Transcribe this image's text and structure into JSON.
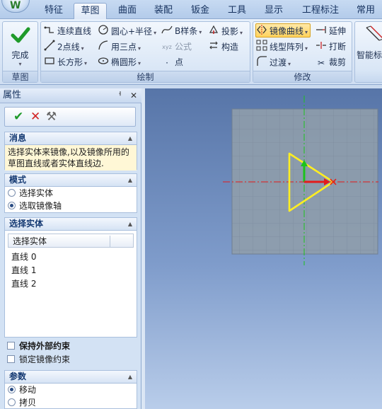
{
  "tabs": [
    {
      "label": "特征",
      "active": false
    },
    {
      "label": "草图",
      "active": true
    },
    {
      "label": "曲面",
      "active": false
    },
    {
      "label": "装配",
      "active": false
    },
    {
      "label": "钣金",
      "active": false
    },
    {
      "label": "工具",
      "active": false
    },
    {
      "label": "显示",
      "active": false
    },
    {
      "label": "工程标注",
      "active": false
    },
    {
      "label": "常用",
      "active": false
    }
  ],
  "ribbon": {
    "sketch_group": {
      "label": "草图",
      "finish_label": "完成"
    },
    "draw_group": {
      "label": "绘制",
      "items": {
        "line": "连续直线",
        "circle": "圆心+半径",
        "bspline": "B样条",
        "project": "投影",
        "two_point": "2点线",
        "three_point": "用三点",
        "formula": "公式",
        "construct": "构造",
        "rectangle": "长方形",
        "ellipse": "椭圆形",
        "point": "点"
      }
    },
    "modify_group": {
      "label": "修改",
      "items": {
        "mirror": "镜像曲线",
        "extend": "延伸",
        "linear_pattern": "线型阵列",
        "break": "打断",
        "fillet": "过渡",
        "trim": "裁剪"
      }
    },
    "dim_group": {
      "smart_dim_label": "智能标"
    }
  },
  "panel": {
    "title": "属性",
    "pin_glyph": "ᅥ",
    "close_glyph": "✕",
    "ok_glyph": "✔",
    "cancel_glyph": "✕",
    "apply_glyph": "⚒",
    "message": {
      "title": "消息",
      "text": "选择实体来镜像,以及镜像所用的草图直线或者实体直线边."
    },
    "mode": {
      "title": "模式",
      "options": [
        {
          "label": "选择实体",
          "selected": false
        },
        {
          "label": "选取镜像轴",
          "selected": true
        }
      ]
    },
    "entities": {
      "title": "选择实体",
      "column": "选择实体",
      "items": [
        "直线 0",
        "直线 1",
        "直线 2"
      ]
    },
    "keep_external": "保持外部约束",
    "lock_mirror": "锁定镜像约束",
    "params": {
      "title": "参数",
      "options": [
        {
          "label": "移动",
          "selected": true
        },
        {
          "label": "拷贝",
          "selected": false
        }
      ]
    }
  },
  "colors": {
    "accent": "#ffd35e",
    "axis_red": "#e31b1b",
    "axis_green": "#1cc21c",
    "sketch_yellow": "#ffee22"
  }
}
